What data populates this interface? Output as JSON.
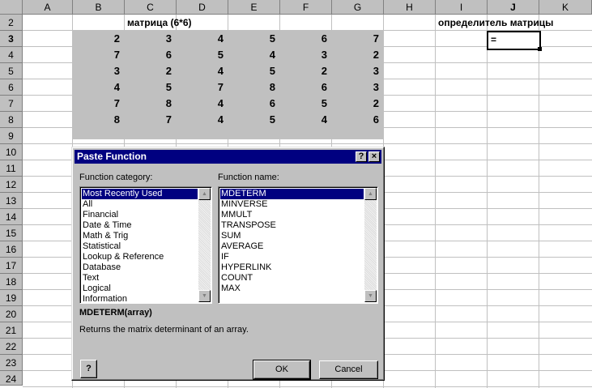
{
  "sheet": {
    "columns": [
      "A",
      "B",
      "C",
      "D",
      "E",
      "F",
      "G",
      "H",
      "I",
      "J",
      "K"
    ],
    "rows": [
      "2",
      "3",
      "4",
      "5",
      "6",
      "7",
      "8",
      "9",
      "10",
      "11",
      "12",
      "13",
      "14",
      "15",
      "16",
      "17",
      "18",
      "19",
      "20",
      "21",
      "22",
      "23",
      "24"
    ],
    "active_column": "J",
    "active_row": "3",
    "matrix_title": "матрица  (6*6)",
    "det_label": "определитель матрицы",
    "active_cell_value": "=",
    "matrix": [
      [
        "2",
        "3",
        "4",
        "5",
        "6",
        "7"
      ],
      [
        "7",
        "6",
        "5",
        "4",
        "3",
        "2"
      ],
      [
        "3",
        "2",
        "4",
        "5",
        "2",
        "3"
      ],
      [
        "4",
        "5",
        "7",
        "8",
        "6",
        "3"
      ],
      [
        "7",
        "8",
        "4",
        "6",
        "5",
        "2"
      ],
      [
        "8",
        "7",
        "4",
        "5",
        "4",
        "6"
      ]
    ]
  },
  "dialog": {
    "title": "Paste Function",
    "help_button": "?",
    "close_button": "×",
    "category_label": "Function category:",
    "name_label": "Function name:",
    "categories": [
      "Most Recently Used",
      "All",
      "Financial",
      "Date & Time",
      "Math & Trig",
      "Statistical",
      "Lookup & Reference",
      "Database",
      "Text",
      "Logical",
      "Information"
    ],
    "selected_category": 0,
    "functions": [
      "MDETERM",
      "MINVERSE",
      "MMULT",
      "TRANSPOSE",
      "SUM",
      "AVERAGE",
      "IF",
      "HYPERLINK",
      "COUNT",
      "MAX"
    ],
    "selected_function": 0,
    "signature": "MDETERM(array)",
    "description": "Returns the matrix determinant of an array.",
    "ok_label": "OK",
    "cancel_label": "Cancel",
    "office_assistant_icon": "?"
  }
}
